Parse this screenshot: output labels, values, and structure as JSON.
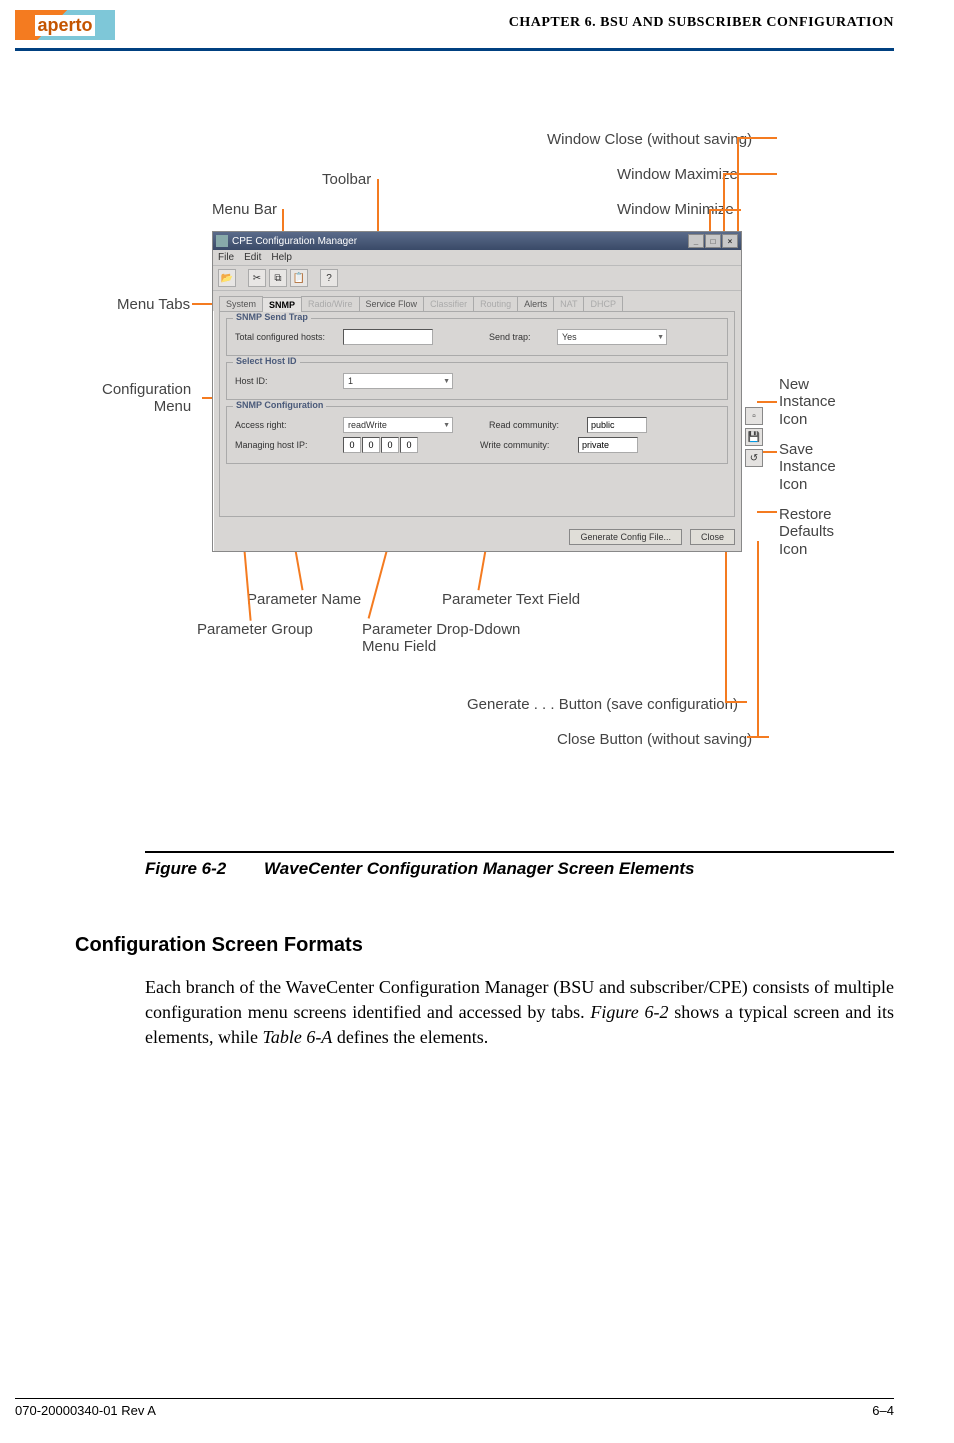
{
  "header": {
    "logo_text": "aperto",
    "chapter": "CHAPTER 6.  BSU AND SUBSCRIBER CONFIGURATION"
  },
  "callouts": {
    "toolbar": "Toolbar",
    "menu_bar": "Menu Bar",
    "menu_tabs": "Menu Tabs",
    "config_menu": "Configuration\nMenu",
    "win_close": "Window Close (without saving)",
    "win_max": "Window Maximize",
    "win_min": "Window Minimize",
    "new_inst": "New\nInstance\nIcon",
    "save_inst": "Save\nInstance\nIcon",
    "restore_def": "Restore\nDefaults\nIcon",
    "param_name": "Parameter Name",
    "param_group": "Parameter Group",
    "param_text": "Parameter Text Field",
    "param_dd": "Parameter Drop-Ddown\nMenu Field",
    "gen_btn": "Generate . . . Button (save configuration)",
    "close_btn": "Close Button (without saving)"
  },
  "app": {
    "title": "CPE Configuration Manager",
    "menus": {
      "file": "File",
      "edit": "Edit",
      "help": "Help"
    },
    "tabs": {
      "system": "System",
      "snmp": "SNMP",
      "radio": "Radio/Wire",
      "svc": "Service Flow",
      "classifier": "Classifier",
      "routing": "Routing",
      "alerts": "Alerts",
      "nat": "NAT",
      "dhcp": "DHCP"
    },
    "group1": {
      "title": "SNMP Send Trap",
      "hosts_lbl": "Total configured hosts:",
      "hosts_val": "",
      "trap_lbl": "Send trap:",
      "trap_val": "Yes"
    },
    "group2": {
      "title": "Select Host ID",
      "hostid_lbl": "Host ID:",
      "hostid_val": "1"
    },
    "group3": {
      "title": "SNMP Configuration",
      "access_lbl": "Access right:",
      "access_val": "readWrite",
      "mgip_lbl": "Managing host IP:",
      "ip": [
        "0",
        "0",
        "0",
        "0"
      ],
      "readc_lbl": "Read community:",
      "readc_val": "public",
      "writec_lbl": "Write community:",
      "writec_val": "private"
    },
    "buttons": {
      "generate": "Generate Config File...",
      "close": "Close"
    }
  },
  "figure": {
    "number": "Figure 6-2",
    "title": "WaveCenter Configuration Manager Screen Elements"
  },
  "body": {
    "heading": "Configuration Screen Formats",
    "para_1a": "Each branch of the WaveCenter Configuration Manager (BSU and subscriber/CPE) consists of multiple configuration menu screens identified and accessed by tabs. ",
    "fig_ref": "Figure 6-2",
    "para_1b": "  shows a typical screen and its elements, while ",
    "tbl_ref": "Table 6-A",
    "para_1c": "  defines the elements."
  },
  "footer": {
    "left": "070-20000340-01 Rev A",
    "right": "6–4"
  }
}
